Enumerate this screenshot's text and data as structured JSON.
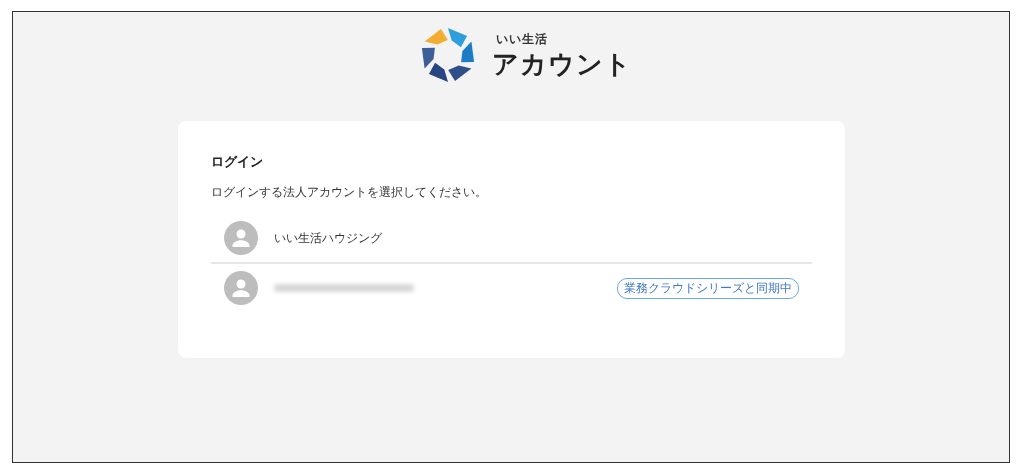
{
  "logo": {
    "subtitle": "いい生活",
    "title": "アカウント"
  },
  "login": {
    "heading": "ログイン",
    "instruction": "ログインする法人アカウントを選択してください。",
    "accounts": [
      {
        "kind": "named",
        "name": "いい生活ハウジング"
      },
      {
        "kind": "redacted",
        "badge": "業務クラウドシリーズと同期中"
      }
    ]
  }
}
